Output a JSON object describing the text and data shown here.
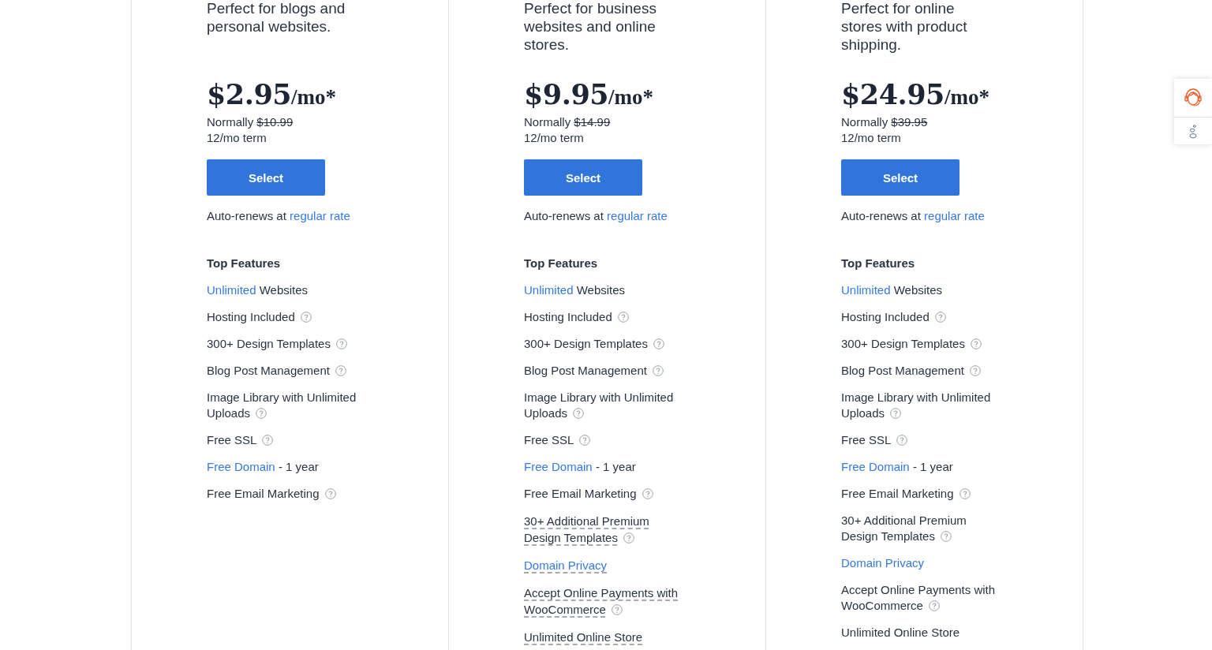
{
  "plans": [
    {
      "description": "Perfect for blogs and personal websites.",
      "price": "$2.95",
      "per": "/mo*",
      "normally_label": "Normally",
      "normally_price": "$10.99",
      "term": "12/mo term",
      "button": "Select",
      "renew_text": "Auto-renews at",
      "renew_link": "regular rate",
      "features_title": "Top Features",
      "features": [
        {
          "link": "Unlimited",
          "lines": [
            "Websites"
          ],
          "help": false,
          "dashed": false
        },
        {
          "lines": [
            "Hosting Included"
          ],
          "help": true,
          "dashed": false
        },
        {
          "lines": [
            "300+ Design Templates"
          ],
          "help": true,
          "dashed": false
        },
        {
          "lines": [
            "Blog Post Management"
          ],
          "help": true,
          "dashed": false
        },
        {
          "lines": [
            "Image Library with Unlimited",
            "Uploads"
          ],
          "help": true,
          "dashed": false
        },
        {
          "lines": [
            "Free SSL"
          ],
          "help": true,
          "dashed": false
        },
        {
          "link": "Free Domain",
          "lines": [
            "- 1 year"
          ],
          "help": false,
          "dashed": false
        },
        {
          "lines": [
            "Free Email Marketing"
          ],
          "help": true,
          "dashed": false
        }
      ]
    },
    {
      "description": "Perfect for business websites and online stores.",
      "price": "$9.95",
      "per": "/mo*",
      "normally_label": "Normally",
      "normally_price": "$14.99",
      "term": "12/mo term",
      "button": "Select",
      "renew_text": "Auto-renews at",
      "renew_link": "regular rate",
      "features_title": "Top Features",
      "features": [
        {
          "link": "Unlimited",
          "lines": [
            "Websites"
          ],
          "help": false,
          "dashed": false
        },
        {
          "lines": [
            "Hosting Included"
          ],
          "help": true,
          "dashed": false
        },
        {
          "lines": [
            "300+ Design Templates"
          ],
          "help": true,
          "dashed": false
        },
        {
          "lines": [
            "Blog Post Management"
          ],
          "help": true,
          "dashed": false
        },
        {
          "lines": [
            "Image Library with Unlimited",
            "Uploads"
          ],
          "help": true,
          "dashed": false
        },
        {
          "lines": [
            "Free SSL"
          ],
          "help": true,
          "dashed": false
        },
        {
          "link": "Free Domain",
          "lines": [
            "- 1 year"
          ],
          "help": false,
          "dashed": false
        },
        {
          "lines": [
            "Free Email Marketing"
          ],
          "help": true,
          "dashed": false
        },
        {
          "lines": [
            "30+ Additional Premium",
            "Design Templates"
          ],
          "help": true,
          "dashed": true
        },
        {
          "link": "Domain Privacy",
          "help": false,
          "dashed": true
        },
        {
          "lines": [
            "Accept Online Payments with",
            "WooCommerce"
          ],
          "help": true,
          "dashed": true
        },
        {
          "lines": [
            "Unlimited Online Store"
          ],
          "help": false,
          "dashed": true
        }
      ]
    },
    {
      "description": "Perfect for online stores with product shipping.",
      "price": "$24.95",
      "per": "/mo*",
      "normally_label": "Normally",
      "normally_price": "$39.95",
      "term": "12/mo term",
      "button": "Select",
      "renew_text": "Auto-renews at",
      "renew_link": "regular rate",
      "features_title": "Top Features",
      "features": [
        {
          "link": "Unlimited",
          "lines": [
            "Websites"
          ],
          "help": false,
          "dashed": false
        },
        {
          "lines": [
            "Hosting Included"
          ],
          "help": true,
          "dashed": false
        },
        {
          "lines": [
            "300+ Design Templates"
          ],
          "help": true,
          "dashed": false
        },
        {
          "lines": [
            "Blog Post Management"
          ],
          "help": true,
          "dashed": false
        },
        {
          "lines": [
            "Image Library with Unlimited",
            "Uploads"
          ],
          "help": true,
          "dashed": false
        },
        {
          "lines": [
            "Free SSL"
          ],
          "help": true,
          "dashed": false
        },
        {
          "link": "Free Domain",
          "lines": [
            "- 1 year"
          ],
          "help": false,
          "dashed": false
        },
        {
          "lines": [
            "Free Email Marketing"
          ],
          "help": true,
          "dashed": false
        },
        {
          "lines": [
            "30+ Additional Premium",
            "Design Templates"
          ],
          "help": true,
          "dashed": false
        },
        {
          "link": "Domain Privacy",
          "help": false,
          "dashed": false
        },
        {
          "lines": [
            "Accept Online Payments with",
            "WooCommerce"
          ],
          "help": true,
          "dashed": false
        },
        {
          "lines": [
            "Unlimited Online Store"
          ],
          "help": false,
          "dashed": false
        }
      ]
    }
  ]
}
